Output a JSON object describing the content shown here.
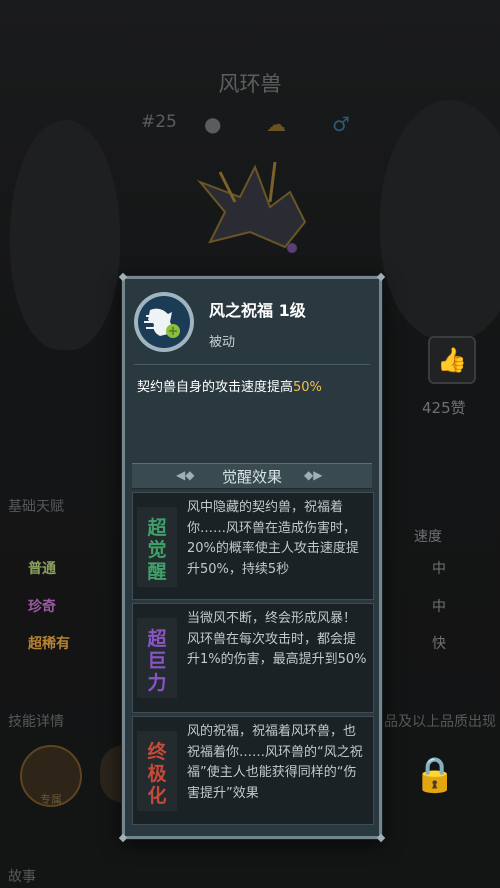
{
  "background": {
    "title": "风环兽",
    "number": "#25",
    "icons": [
      "alien-icon",
      "cloud-icon",
      "male-icon"
    ],
    "like_count": "425赞",
    "sections": {
      "basic_talent": "基础天赋",
      "speed_header": "速度",
      "skill_details": "技能详情",
      "quality_note": "品及以上品质出现",
      "story": "故事"
    },
    "tiers": [
      {
        "label": "普通",
        "speed": "中",
        "color": "#b8d07a"
      },
      {
        "label": "珍奇",
        "speed": "中",
        "color": "#c472c9"
      },
      {
        "label": "超稀有",
        "speed": "快",
        "color": "#e0a23c"
      }
    ],
    "skill_icon_caption": "专属"
  },
  "modal": {
    "skill_name": "风之祝福 1级",
    "skill_type": "被动",
    "description_prefix": "契约兽自身的攻击速度提高",
    "description_highlight": "50%",
    "awakening_title": "觉醒效果",
    "awakenings": [
      {
        "badge": "超觉醒",
        "badge_color": "#3fa06a",
        "text": "风中隐藏的契约兽，祝福着你……风环兽在造成伤害时，20%的概率使主人攻击速度提升50%，持续5秒"
      },
      {
        "badge": "超巨力",
        "badge_color": "#8a54c4",
        "text": "当微风不断，终会形成风暴！风环兽在每次攻击时，都会提升1%的伤害，最高提升到50%"
      },
      {
        "badge": "终极化",
        "badge_color": "#c44a3a",
        "text": "风的祝福，祝福着风环兽，也祝福着你……风环兽的“风之祝福”使主人也能获得同样的“伤害提升”效果"
      }
    ]
  }
}
